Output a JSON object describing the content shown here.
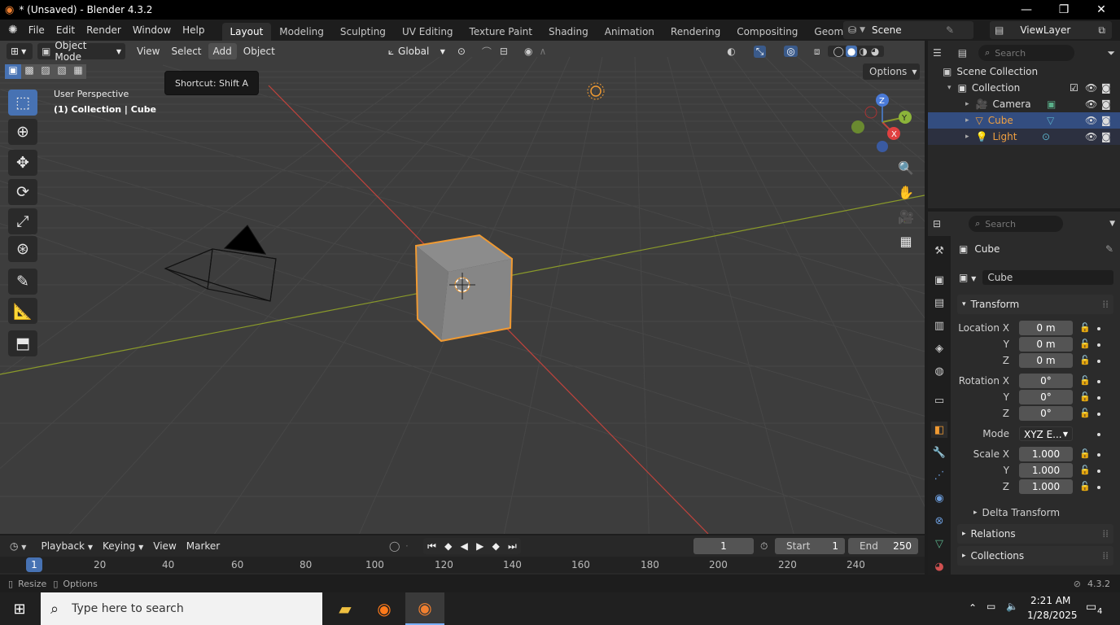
{
  "window": {
    "title": "* (Unsaved) - Blender 4.3.2",
    "min": "—",
    "max": "❐",
    "close": "✕"
  },
  "menu": {
    "file": "File",
    "edit": "Edit",
    "render": "Render",
    "window": "Window",
    "help": "Help"
  },
  "workspaces": [
    "Layout",
    "Modeling",
    "Sculpting",
    "UV Editing",
    "Texture Paint",
    "Shading",
    "Animation",
    "Rendering",
    "Compositing",
    "Geometry Nod"
  ],
  "scene": {
    "name": "Scene",
    "viewlayer": "ViewLayer"
  },
  "viewport": {
    "mode": "Object Mode",
    "menus": {
      "view": "View",
      "select": "Select",
      "add": "Add",
      "object": "Object"
    },
    "orientation": "Global",
    "options": "Options",
    "tooltip": "Shortcut: Shift A",
    "overlay_line1": "User Perspective",
    "overlay_line2": "(1) Collection | Cube",
    "gizmo": {
      "x": "X",
      "y": "Y",
      "z": "Z"
    }
  },
  "outliner": {
    "search_placeholder": "Search",
    "scene_collection": "Scene Collection",
    "collection": "Collection",
    "items": [
      {
        "name": "Camera",
        "selected": false,
        "color": "#e6e6e6"
      },
      {
        "name": "Cube",
        "selected": true,
        "color": "#f0a040"
      },
      {
        "name": "Light",
        "selected": false,
        "color": "#f0a040"
      }
    ]
  },
  "properties": {
    "search_placeholder": "Search",
    "object_name": "Cube",
    "data_name": "Cube",
    "transform": "Transform",
    "location_label": "Location X",
    "y": "Y",
    "z": "Z",
    "location": [
      "0 m",
      "0 m",
      "0 m"
    ],
    "rotation_label": "Rotation X",
    "rotation": [
      "0°",
      "0°",
      "0°"
    ],
    "mode_label": "Mode",
    "mode_value": "XYZ E...",
    "scale_label": "Scale X",
    "scale": [
      "1.000",
      "1.000",
      "1.000"
    ],
    "delta": "Delta Transform",
    "relations": "Relations",
    "collections": "Collections"
  },
  "timeline": {
    "playback": "Playback",
    "keying": "Keying",
    "view": "View",
    "marker": "Marker",
    "current_frame": "1",
    "start_label": "Start",
    "start": "1",
    "end_label": "End",
    "end": "250",
    "ticks": [
      "1",
      "20",
      "40",
      "60",
      "80",
      "100",
      "120",
      "140",
      "160",
      "180",
      "200",
      "220",
      "240"
    ]
  },
  "status": {
    "resize": "Resize",
    "options": "Options",
    "version": "4.3.2"
  },
  "taskbar": {
    "search_placeholder": "Type here to search",
    "time": "2:21 AM",
    "date": "1/28/2025",
    "notif": "4"
  },
  "colors": {
    "accent": "#4772b3",
    "selection": "#f09a32",
    "x_axis": "#c0433c",
    "y_axis": "#8a9a2a"
  }
}
